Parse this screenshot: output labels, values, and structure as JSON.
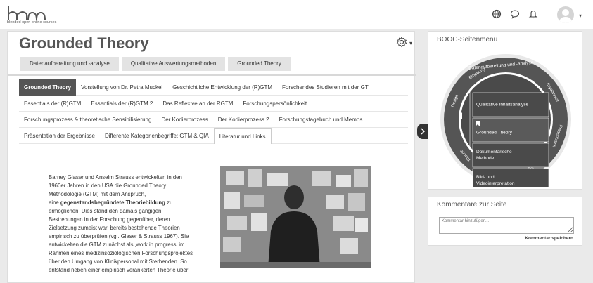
{
  "header": {
    "logo_sub": "blended open online courses",
    "icons": [
      "globe-icon",
      "chat-icon",
      "bell-icon"
    ]
  },
  "page": {
    "title": "Grounded Theory",
    "primary_tabs": [
      "Datenaufbereitung und -analyse",
      "Qualitative Auswertungsmethoden",
      "Grounded Theory"
    ],
    "secondary_tabs": [
      [
        "Grounded Theory",
        "Vorstellung von Dr. Petra Muckel",
        "Geschichtliche Entwicklung der (R)GTM",
        "Forschendes Studieren mit der GT"
      ],
      [
        "Essentials der (R)GTM",
        "Essentials der (R)GTM 2",
        "Das Reflexive an der RGTM",
        "Forschungspersönlichkeit"
      ],
      [
        "Forschungsprozess & theoretische Sensibilisierung",
        "Der Kodierprozess",
        "Der Kodierprozess 2",
        "Forschungstagebuch und Memos"
      ],
      [
        "Präsentation der Ergebnisse",
        "Differente Kategorienbegriffe: GTM & QIA",
        "Literatur und Links"
      ]
    ],
    "body": {
      "part1": "Barney Glaser und Anselm Strauss entwickelten in den\n1960er Jahren in den USA  die Grounded Theory\nMethodologie (GTM) mit dem Anspruch,\neine ",
      "bold": "gegenstandsbegründete Theoriebildung",
      "part2": " zu\nermöglichen. Dies stand den damals gängigen\nBestrebungen in der Forschung gegenüber,  deren\nZielsetzung zumeist war, bereits bestehende Theorien\nempirisch zu überprüfen (vgl.  Glaser & Strauss 1967). Sie\nentwickelten die GTM zunächst als ‚work in progress' im\nRahmen eines  medizinsoziologischen Forschungsprojektes\nüber den Umgang von Klinikpersonal mit Sterbenden. So\nentstand neben einer empirisch verankerten Theorie über"
    }
  },
  "sidebar": {
    "title": "BOOC-Seitenmenü",
    "ring_labels": [
      "Datenaufbereitung und -analyse",
      "Ergebnisse",
      "Präsentation",
      "Abschluss",
      "Thema",
      "Theorie",
      "Design",
      "Erhebung"
    ],
    "menu": [
      "Qualitative Inhaltsanalyse",
      "Grounded Theory",
      "Dokumentarische Methode",
      "Bild- und Videointerpretation"
    ],
    "menu_lines": [
      [
        "Qualitative Inhaltsanalyse"
      ],
      [
        "Grounded Theory"
      ],
      [
        "Dokumentarische",
        "Methode"
      ],
      [
        "Bild- und",
        "Videointerpretation"
      ]
    ]
  },
  "comments": {
    "title": "Kommentare zur Seite",
    "placeholder": "Kommentar hinzufügen...",
    "save": "Kommentar speichern"
  }
}
